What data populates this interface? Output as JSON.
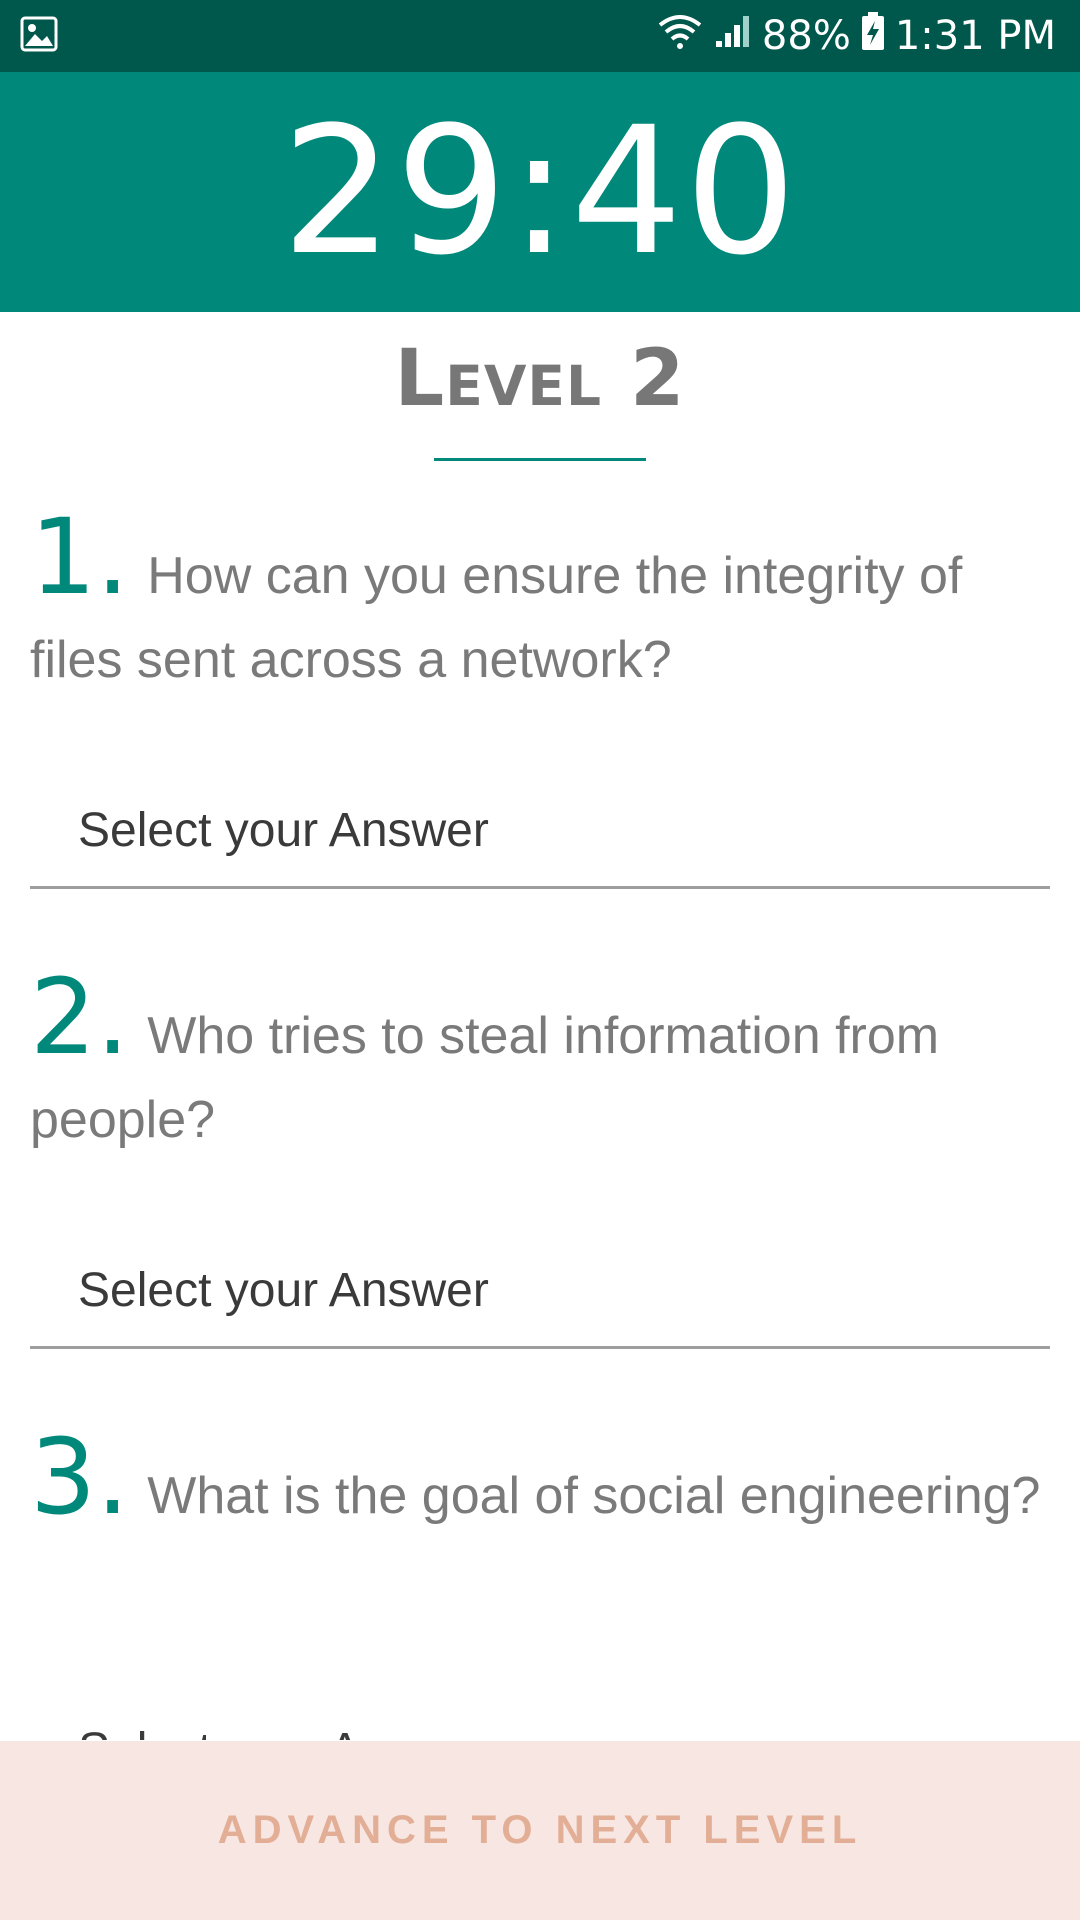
{
  "status_bar": {
    "battery": "88%",
    "time": "1:31 PM",
    "icons": [
      "image-icon",
      "wifi-icon",
      "signal-icon",
      "battery-charging-icon"
    ]
  },
  "timer": {
    "value": "29:40"
  },
  "level": {
    "title": "Level 2"
  },
  "questions": [
    {
      "number": "1.",
      "text": "How can you ensure the integrity of files sent across a network?",
      "answer_placeholder": "Select your Answer"
    },
    {
      "number": "2.",
      "text": "Who tries to steal information from people?",
      "answer_placeholder": "Select your Answer"
    },
    {
      "number": "3.",
      "text": "What is the goal of social engineering?",
      "answer_placeholder": "Select your Answer"
    }
  ],
  "footer": {
    "button_label": "ADVANCE TO NEXT LEVEL"
  },
  "colors": {
    "status_bar": "#00574b",
    "primary": "#00897b",
    "footer_bg": "#f7e6e1",
    "footer_text": "#e2ae96"
  }
}
